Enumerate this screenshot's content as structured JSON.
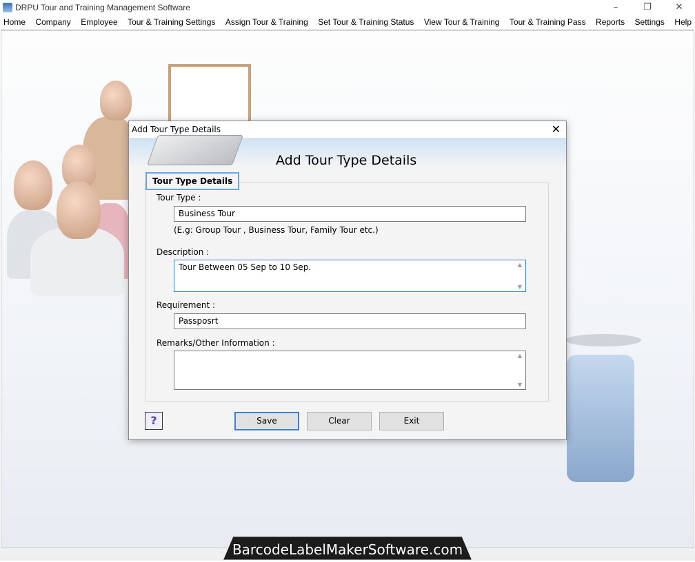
{
  "window": {
    "title": "DRPU Tour and Training Management Software",
    "minimize": "–",
    "restore": "❐",
    "close": "✕"
  },
  "menu": [
    "Home",
    "Company",
    "Employee",
    "Tour & Training Settings",
    "Assign Tour & Training",
    "Set Tour & Training Status",
    "View Tour & Training",
    "Tour & Training Pass",
    "Reports",
    "Settings",
    "Help"
  ],
  "dialog": {
    "title": "Add Tour Type Details",
    "close": "✕",
    "banner_title": "Add Tour Type Details",
    "group_title": "Tour Type Details",
    "tour_type_label": "Tour Type :",
    "tour_type_value": "Business Tour",
    "tour_type_hint": "(E.g: Group Tour , Business Tour, Family Tour etc.)",
    "description_label": "Description :",
    "description_value": "Tour Between 05 Sep to 10 Sep.",
    "requirement_label": "Requirement :",
    "requirement_value": "Passposrt",
    "remarks_label": "Remarks/Other Information :",
    "remarks_value": "",
    "help": "?",
    "save": "Save",
    "clear": "Clear",
    "exit": "Exit"
  },
  "watermark": "BarcodeLabelMakerSoftware.com"
}
